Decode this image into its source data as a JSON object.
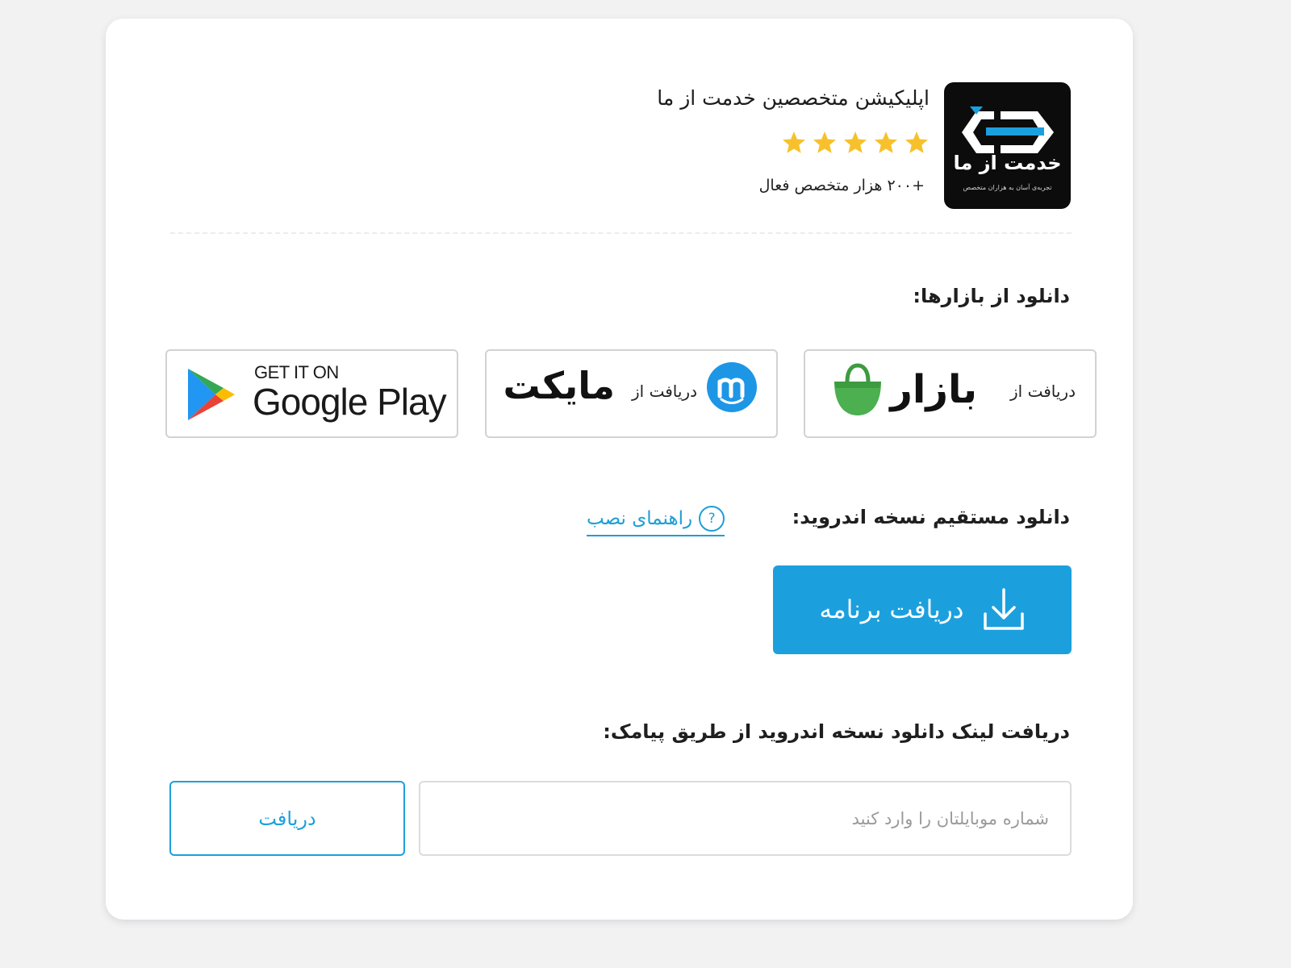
{
  "header": {
    "logo_text": "خدمت از ما",
    "logo_tagline": "تجربه‌ی آسان به هزاران متخصص",
    "app_title": "اپلیکیشن متخصصین خدمت از ما",
    "rating_stars": 5,
    "experts_count": "+۲۰۰ هزار متخصص فعال"
  },
  "markets": {
    "title": "دانلود از بازارها:",
    "bazaar": {
      "small": "دریافت از",
      "name": "بازار"
    },
    "myket": {
      "small": "دریافت از",
      "name": "مایکت"
    },
    "google_play": {
      "small": "GET IT ON",
      "name": "Google Play"
    }
  },
  "direct": {
    "title": "دانلود مستقیم نسخه اندروید:",
    "install_guide": "راهنمای نصب",
    "help_symbol": "?",
    "download_button": "دریافت برنامه"
  },
  "sms": {
    "title": "دریافت لینک دانلود نسخه اندروید از طریق پیامک:",
    "phone_placeholder": "شماره موبایلتان را وارد کنید",
    "phone_value": "",
    "receive_button": "دریافت"
  },
  "colors": {
    "accent": "#1ca0dd",
    "star": "#f6c12c",
    "bazaar_green": "#4caf50",
    "myket_blue": "#1e96e6"
  },
  "icons": {
    "logo": "khedmat-az-ma-logo",
    "star": "star-icon",
    "bazaar": "bazaar-bag-icon",
    "myket": "myket-icon",
    "google_play": "google-play-icon",
    "help": "question-icon",
    "download": "download-icon"
  }
}
